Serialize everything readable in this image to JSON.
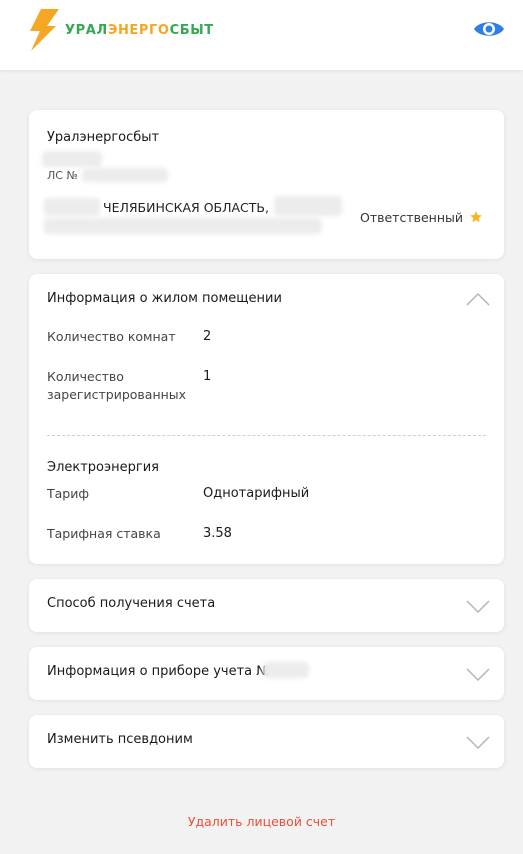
{
  "header": {
    "logo_text_part1": "УРАЛ",
    "logo_text_part2": "ЭНЕРГО",
    "logo_text_part3": "СБЫТ",
    "brand_colors": {
      "green": "#35a854",
      "orange": "#f5a623",
      "accent_blue": "#2f7fe6"
    },
    "eye_icon": "eye-icon"
  },
  "account_card": {
    "company": "Уралэнергосбыт",
    "account_prefix": "ЛС №",
    "address_visible": "ЧЕЛЯБИНСКАЯ ОБЛАСТЬ,",
    "role": "Ответственный",
    "role_icon": "star-icon"
  },
  "housing_info": {
    "title": "Информация о жилом помещении",
    "rooms_label": "Количество комнат",
    "rooms_value": "2",
    "registered_label_line1": "Количество",
    "registered_label_line2": "зарегистрированных",
    "registered_value": "1",
    "electricity_title": "Электроэнергия",
    "tariff_label": "Тариф",
    "tariff_value": "Однотарифный",
    "rate_label": "Тарифная ставка",
    "rate_value": "3.58"
  },
  "sections": {
    "bill_delivery": "Способ получения счета",
    "meter_info": "Информация о приборе учета №",
    "change_alias": "Изменить псевдоним"
  },
  "footer": {
    "delete_account": "Удалить лицевой счет"
  }
}
